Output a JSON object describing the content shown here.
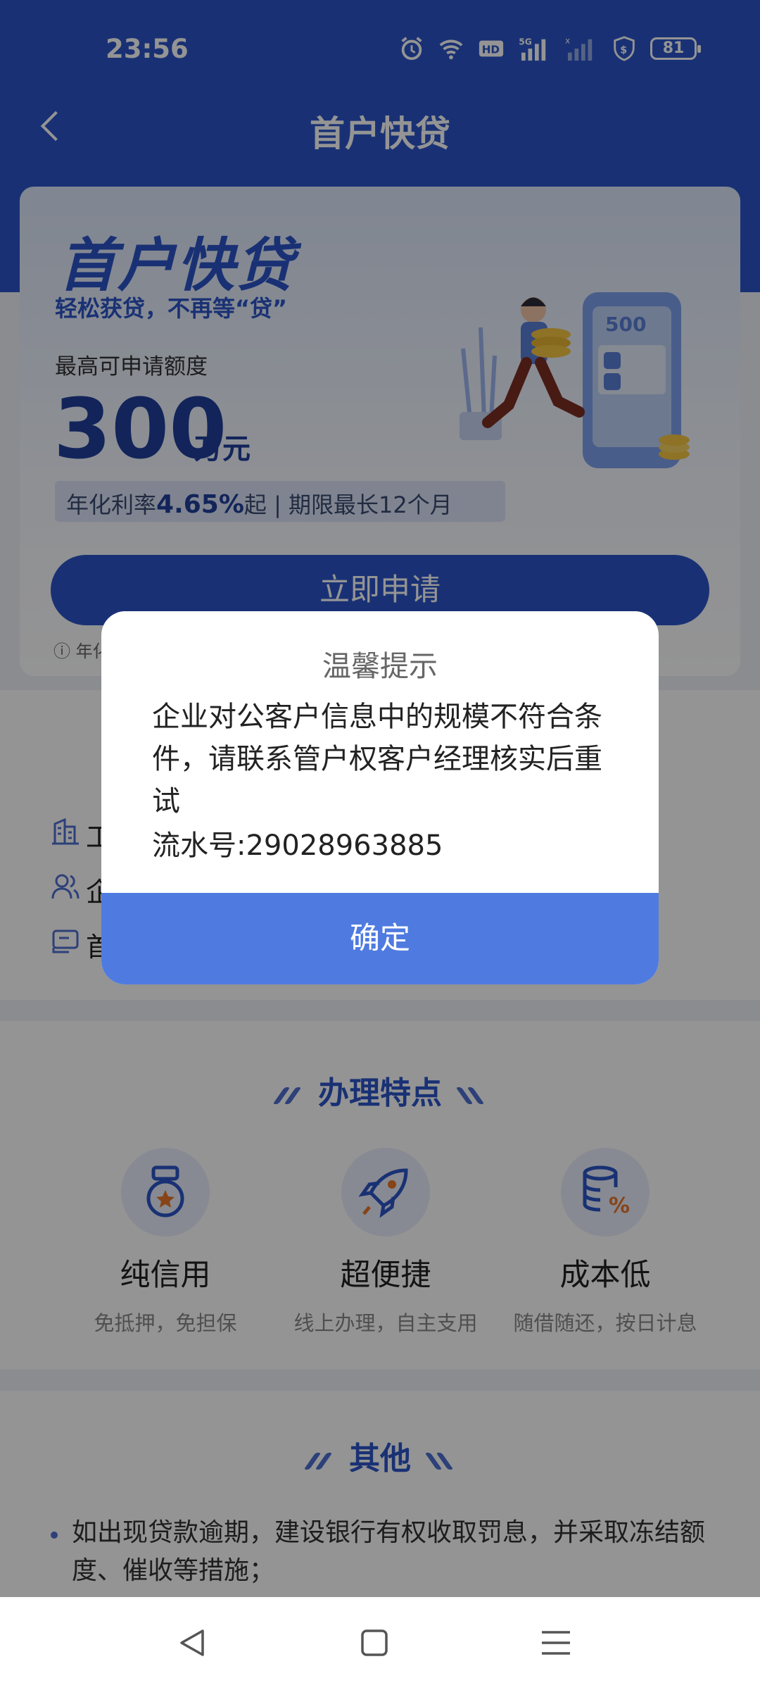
{
  "status_bar": {
    "time": "23:56",
    "battery": "81"
  },
  "nav": {
    "title": "首户快贷"
  },
  "hero": {
    "title": "首户快贷",
    "subtitle": "轻松获贷，不再等“贷”",
    "limit_label": "最高可申请额度",
    "amount": "300",
    "unit": "万元",
    "rate_prefix": "年化利率",
    "rate_value": "4.65%",
    "rate_suffix": "起 | 期限最长12个月",
    "illus_amount": "500",
    "apply_label": "立即申请",
    "note": "ⓘ 年化"
  },
  "info_rows": [
    {
      "icon": "building-icon",
      "label": "工"
    },
    {
      "icon": "people-icon",
      "label": "企"
    },
    {
      "icon": "card-icon",
      "label": "首"
    }
  ],
  "features": {
    "title": "办理特点",
    "items": [
      {
        "icon": "medal-icon",
        "title": "纯信用",
        "desc": "免抵押，免担保"
      },
      {
        "icon": "rocket-icon",
        "title": "超便捷",
        "desc": "线上办理，自主支用"
      },
      {
        "icon": "coins-percent-icon",
        "title": "成本低",
        "desc": "随借随还，按日计息"
      }
    ]
  },
  "other": {
    "title": "其他",
    "item": "如出现贷款逾期，建设银行有权收取罚息，并采取冻结额度、催收等措施；"
  },
  "dialog": {
    "title": "温馨提示",
    "message": "企业对公客户信息中的规模不符合条件，请联系管户权客户经理核实后重试",
    "serial": "流水号:29028963885",
    "confirm": "确定"
  },
  "colors": {
    "primary": "#2b55c8",
    "dialog_button": "#4f7be0"
  }
}
